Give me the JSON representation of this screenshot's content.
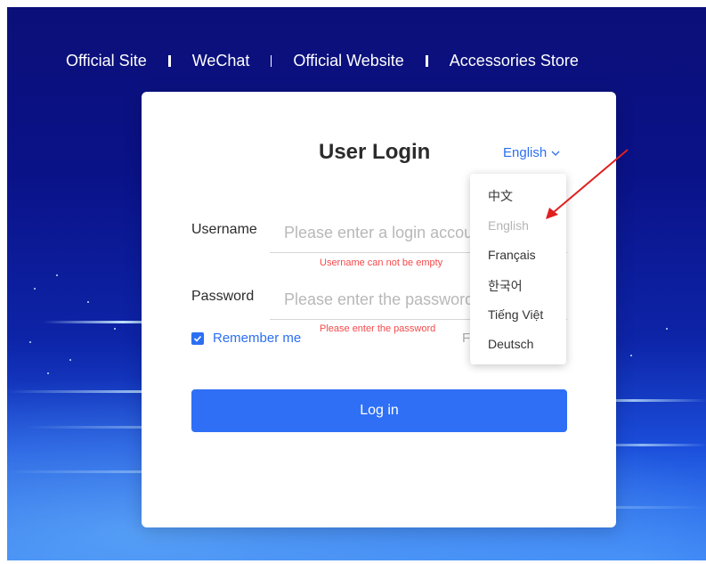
{
  "topnav": {
    "links": [
      "Official Site",
      "WeChat",
      "Official Website",
      "Accessories Store"
    ]
  },
  "login": {
    "title": "User Login",
    "language_current": "English",
    "username_label": "Username",
    "username_placeholder": "Please enter a login account",
    "username_error": "Username can not be empty",
    "password_label": "Password",
    "password_placeholder": "Please enter the password",
    "password_error": "Please enter the password",
    "remember_label": "Remember me",
    "forgot_label": "F",
    "login_button": "Log in"
  },
  "language_menu": {
    "options": [
      "中文",
      "English",
      "Français",
      "한국어",
      "Tiếng Việt",
      "Deutsch"
    ],
    "disabled_option": "English"
  },
  "colors": {
    "accent": "#2e6ff5",
    "error": "#f5494a",
    "annotation_arrow": "#e02020"
  }
}
